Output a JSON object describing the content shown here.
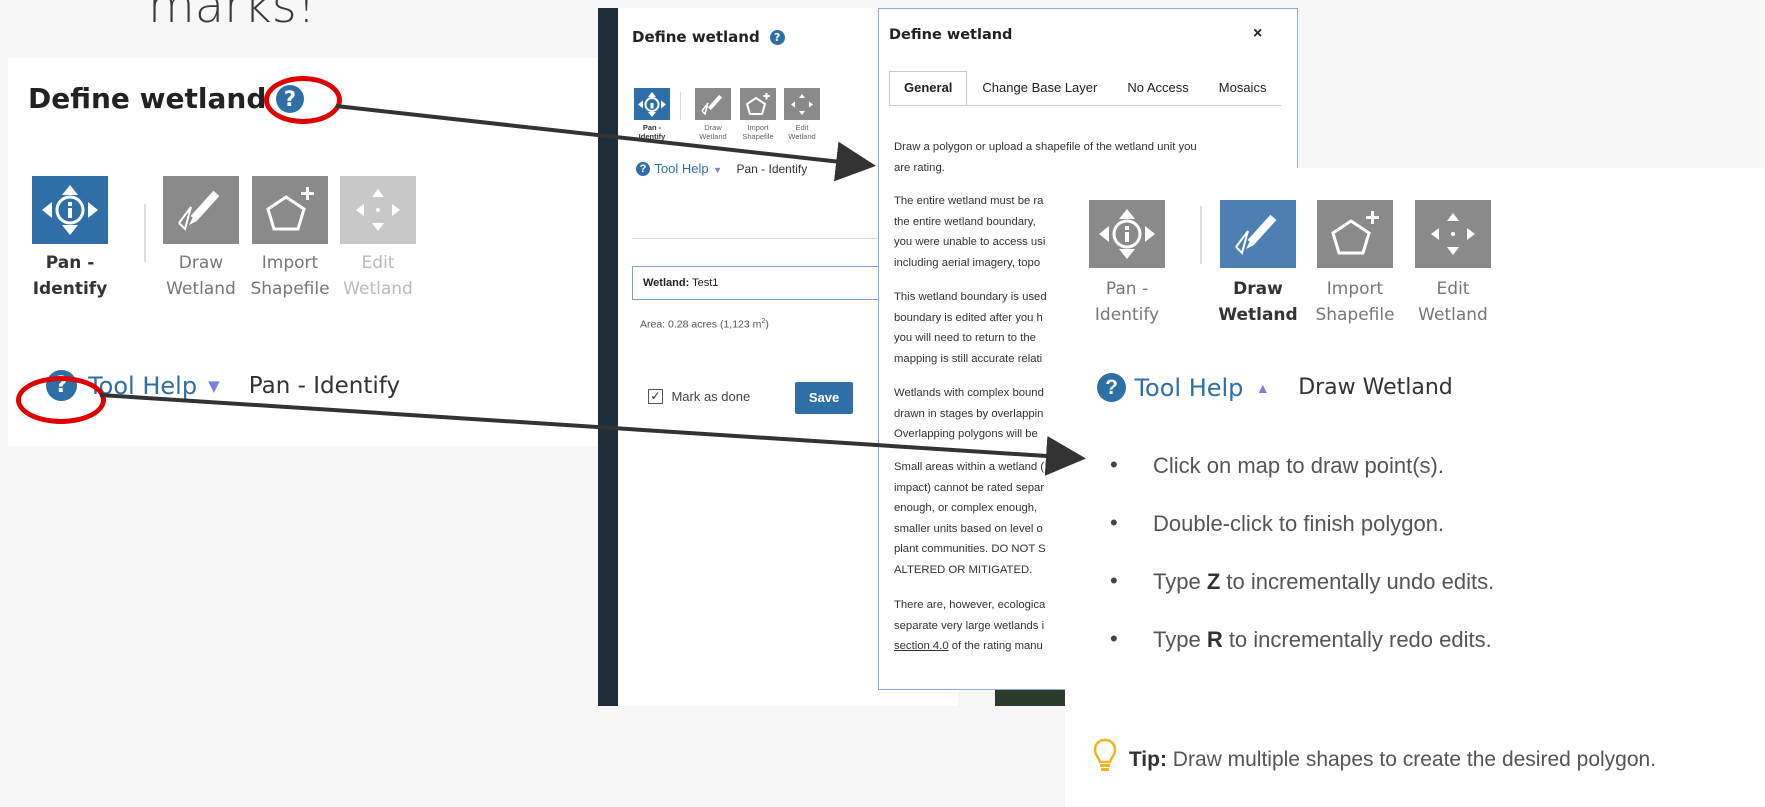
{
  "slide": {
    "heading_fragment": "marks!"
  },
  "left_zoom": {
    "title": "Define wetland",
    "help_glyph": "?",
    "tools": [
      {
        "label_line1": "Pan -",
        "label_line2": "Identify",
        "icon": "pan-identify-icon"
      },
      {
        "label_line1": "Draw",
        "label_line2": "Wetland",
        "icon": "draw-wetland-icon"
      },
      {
        "label_line1": "Import",
        "label_line2": "Shapefile",
        "icon": "import-shapefile-icon"
      },
      {
        "label_line1": "Edit",
        "label_line2": "Wetland",
        "icon": "edit-wetland-icon"
      }
    ],
    "tool_help_label": "Tool Help",
    "tool_help_caret": "▼",
    "current_tool": "Pan - Identify"
  },
  "app": {
    "panel_title": "Define wetland",
    "help_glyph": "?",
    "tools": [
      {
        "label_line1": "Pan -",
        "label_line2": "Identify"
      },
      {
        "label_line1": "Draw",
        "label_line2": "Wetland"
      },
      {
        "label_line1": "Import",
        "label_line2": "Shapefile"
      },
      {
        "label_line1": "Edit",
        "label_line2": "Wetland"
      }
    ],
    "tool_help_label": "Tool Help",
    "tool_help_caret": "▼",
    "current_tool": "Pan - Identify",
    "wetland_label": "Wetland:",
    "wetland_name": "Test1",
    "area_text": "Area: 0.28 acres (1,123 m",
    "area_superscript": "2",
    "area_close": ")",
    "mark_done_check": "✓",
    "mark_done_label": "Mark as done",
    "save_label": "Save"
  },
  "dialog": {
    "title": "Define wetland",
    "close_glyph": "×",
    "tabs": [
      "General",
      "Change Base Layer",
      "No Access",
      "Mosaics"
    ],
    "active_tab": "General",
    "paragraphs": [
      [
        "Draw a polygon or upload a shapefile of the wetland unit you",
        "are rating."
      ],
      [
        "The entire wetland must be ra",
        "the entire wetland boundary, ",
        "you were unable to access usi",
        "including aerial imagery, topo"
      ],
      [
        "This wetland boundary is used",
        "boundary is edited after you h",
        "you will need to return to the",
        "mapping is still accurate relati"
      ],
      [
        "Wetlands with complex bound",
        "drawn in stages by overlappin",
        "Overlapping polygons will be"
      ],
      [
        "Small areas within a wetland (",
        "impact) cannot be rated separ",
        "enough, or complex enough, ",
        "smaller units based on level o",
        "plant communities. DO NOT S",
        "ALTERED OR MITIGATED."
      ],
      [
        "There are, however, ecologica",
        "separate very large wetlands i"
      ]
    ],
    "link_text": "section 4.0",
    "link_suffix": " of the rating manu"
  },
  "right_zoom": {
    "tools": [
      {
        "label_line1": "Pan -",
        "label_line2": "Identify",
        "icon": "pan-identify-icon",
        "active": false
      },
      {
        "label_line1": "Draw",
        "label_line2": "Wetland",
        "icon": "draw-wetland-icon",
        "active": true
      },
      {
        "label_line1": "Import",
        "label_line2": "Shapefile",
        "icon": "import-shapefile-icon",
        "active": false
      },
      {
        "label_line1": "Edit",
        "label_line2": "Wetland",
        "icon": "edit-wetland-icon",
        "active": false
      }
    ],
    "help_glyph": "?",
    "tool_help_label": "Tool Help",
    "tool_help_caret": "▲",
    "current_tool": "Draw Wetland",
    "instructions": [
      {
        "before": "Click on map to draw point(s).",
        "key": "",
        "after": ""
      },
      {
        "before": "Double-click to finish polygon.",
        "key": "",
        "after": ""
      },
      {
        "before": "Type ",
        "key": "Z",
        "after": " to incrementally undo edits."
      },
      {
        "before": "Type ",
        "key": "R",
        "after": " to incrementally redo edits."
      }
    ],
    "tip_label": "Tip:",
    "tip_text": " Draw multiple shapes to create the desired polygon."
  },
  "colors": {
    "annotation_red": "#e00000",
    "help_blue": "#2f6fa8",
    "active_tool_blue": "#4d7fb3",
    "inactive_tool_gray": "#8a8a8a",
    "disabled_tool_gray": "#c8c8c8",
    "sidebar_dark": "#1e2d3a",
    "tip_bulb": "#f0b41e"
  }
}
